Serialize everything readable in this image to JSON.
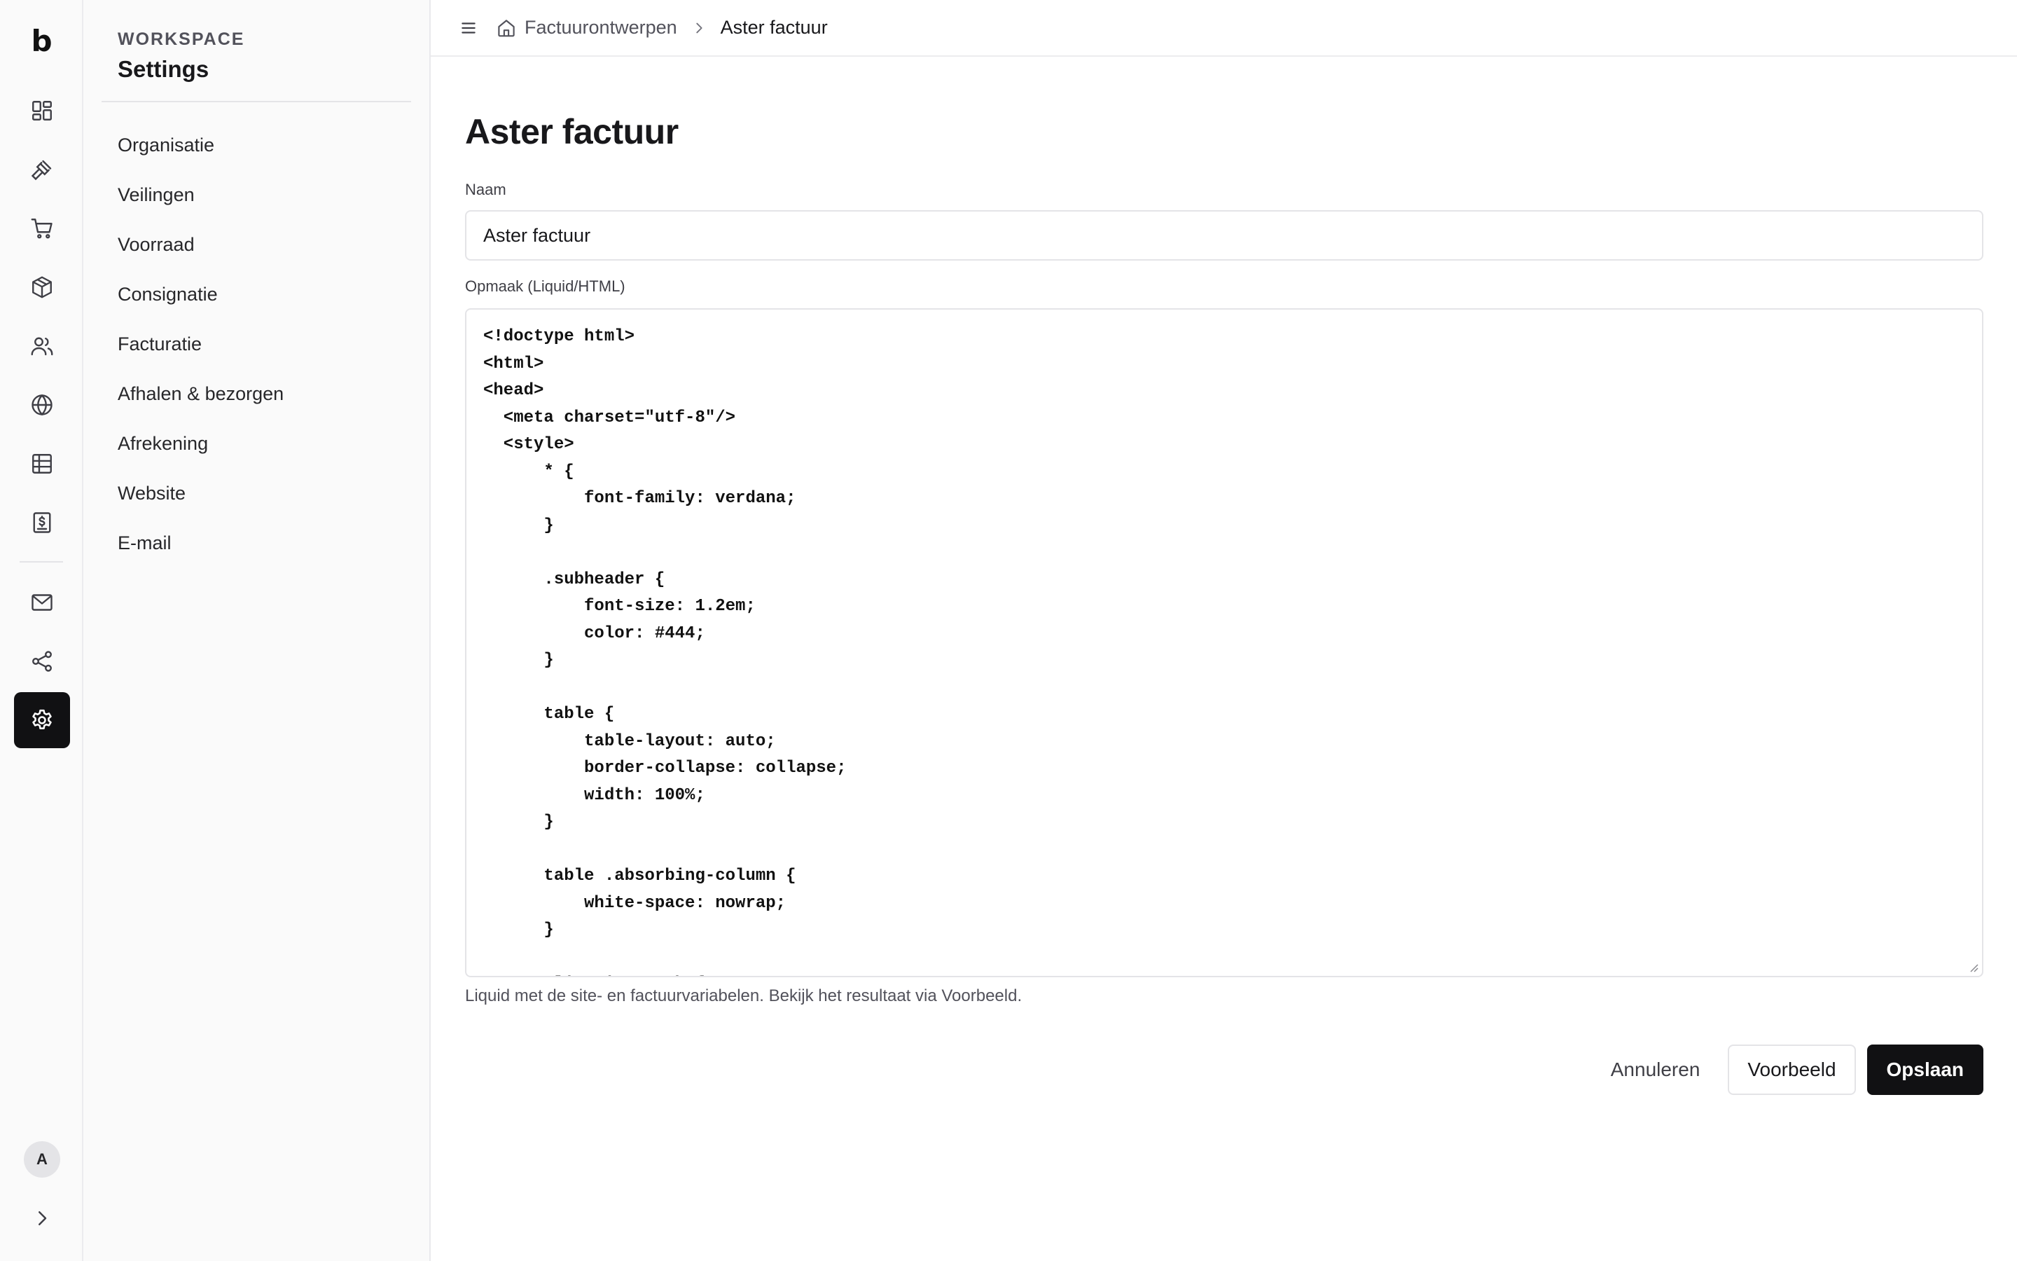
{
  "rail": {
    "logo": "b",
    "avatar_initial": "A",
    "items": [
      {
        "icon": "dashboard-icon"
      },
      {
        "icon": "gavel-icon"
      },
      {
        "icon": "cart-icon"
      },
      {
        "icon": "package-icon"
      },
      {
        "icon": "users-icon"
      },
      {
        "icon": "globe-icon"
      },
      {
        "icon": "table-icon"
      },
      {
        "icon": "receipt-icon"
      },
      {
        "icon": "mail-icon"
      },
      {
        "icon": "share-icon"
      },
      {
        "icon": "gear-icon",
        "active": true
      }
    ]
  },
  "sidebar": {
    "eyebrow": "WORKSPACE",
    "title": "Settings",
    "items": [
      {
        "label": "Organisatie"
      },
      {
        "label": "Veilingen"
      },
      {
        "label": "Voorraad"
      },
      {
        "label": "Consignatie"
      },
      {
        "label": "Facturatie"
      },
      {
        "label": "Afhalen & bezorgen"
      },
      {
        "label": "Afrekening"
      },
      {
        "label": "Website"
      },
      {
        "label": "E-mail"
      }
    ]
  },
  "breadcrumb": {
    "parent": "Factuurontwerpen",
    "current": "Aster factuur"
  },
  "form": {
    "title": "Aster factuur",
    "name_label": "Naam",
    "name_value": "Aster factuur",
    "markup_label": "Opmaak (Liquid/HTML)",
    "markup_value": "<!doctype html>\n<html>\n<head>\n  <meta charset=\"utf-8\"/>\n  <style>\n      * {\n          font-family: verdana;\n      }\n\n      .subheader {\n          font-size: 1.2em;\n          color: #444;\n      }\n\n      table {\n          table-layout: auto;\n          border-collapse: collapse;\n          width: 100%;\n      }\n\n      table .absorbing-column {\n          white-space: nowrap;\n      }\n\n      #line-items th {",
    "help_text": "Liquid met de site- en factuurvariabelen. Bekijk het resultaat via Voorbeeld."
  },
  "actions": {
    "cancel": "Annuleren",
    "preview": "Voorbeeld",
    "save": "Opslaan"
  },
  "colors": {
    "primary": "#111113",
    "border": "#e4e4e7",
    "sidebar_bg": "#fafafa"
  }
}
